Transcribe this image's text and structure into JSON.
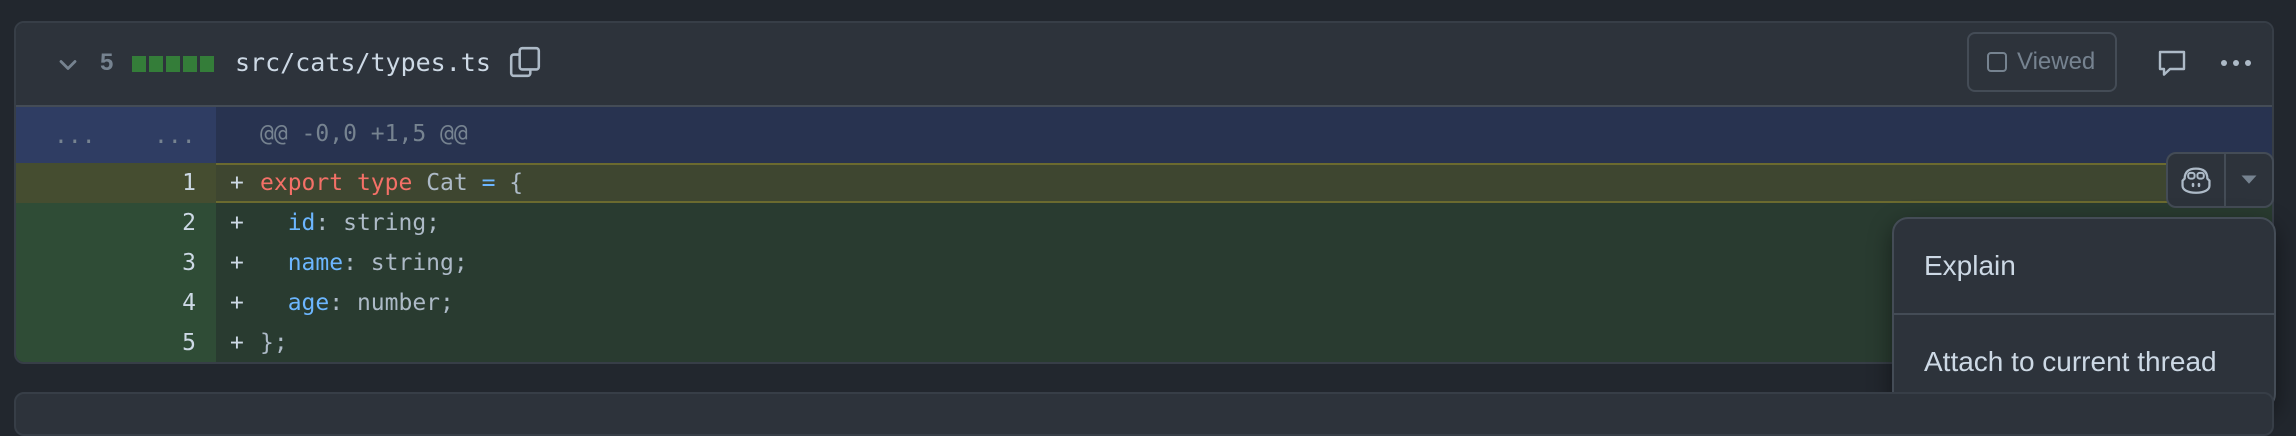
{
  "file": {
    "change_count": "5",
    "diffstat_blocks": 5,
    "path": "src/cats/types.ts",
    "viewed_label": "Viewed"
  },
  "hunk": {
    "old_marker": "...",
    "new_marker": "...",
    "header": "@@ -0,0 +1,5 @@"
  },
  "lines": [
    {
      "number": "1",
      "sign": "+",
      "tokens": [
        {
          "t": "export",
          "c": "kw"
        },
        {
          "t": " ",
          "c": "plain"
        },
        {
          "t": "type",
          "c": "kw"
        },
        {
          "t": " Cat ",
          "c": "plain"
        },
        {
          "t": "=",
          "c": "op"
        },
        {
          "t": " {",
          "c": "plain"
        }
      ]
    },
    {
      "number": "2",
      "sign": "+",
      "tokens": [
        {
          "t": "  ",
          "c": "plain"
        },
        {
          "t": "id",
          "c": "prop"
        },
        {
          "t": ": string;",
          "c": "plain"
        }
      ]
    },
    {
      "number": "3",
      "sign": "+",
      "tokens": [
        {
          "t": "  ",
          "c": "plain"
        },
        {
          "t": "name",
          "c": "prop"
        },
        {
          "t": ": string;",
          "c": "plain"
        }
      ]
    },
    {
      "number": "4",
      "sign": "+",
      "tokens": [
        {
          "t": "  ",
          "c": "plain"
        },
        {
          "t": "age",
          "c": "prop"
        },
        {
          "t": ": number;",
          "c": "plain"
        }
      ]
    },
    {
      "number": "5",
      "sign": "+",
      "tokens": [
        {
          "t": "};",
          "c": "plain"
        }
      ]
    }
  ],
  "menu": {
    "explain": "Explain",
    "attach": "Attach to current thread"
  },
  "icons": {
    "collapse": "chevron-down-icon",
    "copy": "copy-icon",
    "comment": "comment-icon",
    "more": "kebab-horizontal-icon",
    "copilot": "copilot-icon",
    "dropdown": "triangle-down-icon"
  },
  "colors": {
    "background": "#22272e",
    "header": "#2d333b",
    "added_line": "#293b30",
    "added_gutter": "#2f4c36",
    "hunk": "#283350",
    "keyword": "#f47067",
    "property": "#6cb6ff",
    "diffstat": "#347d39"
  }
}
